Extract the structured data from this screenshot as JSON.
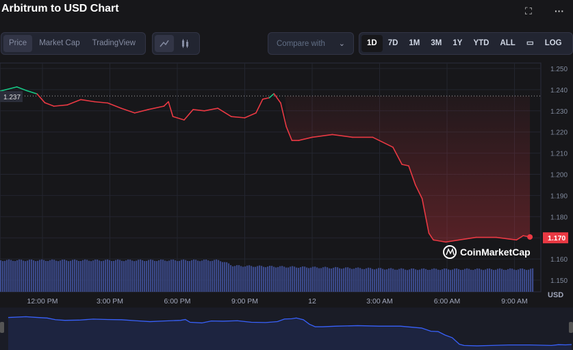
{
  "header": {
    "title": "Arbitrum to USD Chart"
  },
  "tabs": [
    {
      "label": "Price"
    },
    {
      "label": "Market Cap"
    },
    {
      "label": "TradingView"
    }
  ],
  "compare": {
    "label": "Compare with"
  },
  "ranges": [
    {
      "label": "1D"
    },
    {
      "label": "7D"
    },
    {
      "label": "1M"
    },
    {
      "label": "3M"
    },
    {
      "label": "1Y"
    },
    {
      "label": "YTD"
    },
    {
      "label": "ALL"
    }
  ],
  "log_label": "LOG",
  "watermark": "CoinMarketCap",
  "colors": {
    "down": "#ea3943",
    "up": "#16c784",
    "volume": "#3b4a8a",
    "nav": "#3861fb"
  },
  "chart_data": {
    "type": "line",
    "title": "Arbitrum to USD Chart",
    "ylabel": "USD",
    "ylim": [
      1.145,
      1.252
    ],
    "yticks": [
      "1.250",
      "1.240",
      "1.230",
      "1.220",
      "1.210",
      "1.200",
      "1.190",
      "1.180",
      "1.170",
      "1.160",
      "1.150"
    ],
    "xticks": [
      "12:00 PM",
      "3:00 PM",
      "6:00 PM",
      "9:00 PM",
      "12",
      "3:00 AM",
      "6:00 AM",
      "9:00 AM"
    ],
    "open_price": "1.237",
    "current_price": "1.170",
    "x_hours": [
      0,
      0.75,
      1.2,
      1.65,
      2,
      2.4,
      3,
      3.6,
      4.2,
      4.8,
      5.4,
      6,
      6.6,
      7.3,
      7.5,
      7.7,
      8.2,
      8.6,
      9.1,
      9.7,
      10.3,
      10.9,
      11.4,
      11.7,
      12,
      12.2,
      12.5,
      12.75,
      13,
      13.3,
      13.9,
      14.8,
      15.7,
      16.6,
      17.5,
      17.9,
      18.2,
      18.5,
      18.8,
      19.1,
      19.3,
      19.85,
      20.45,
      21.2,
      22.1,
      23,
      23.3,
      23.6
    ],
    "values": [
      1.2393,
      1.2413,
      1.2395,
      1.238,
      1.2338,
      1.2322,
      1.2328,
      1.2353,
      1.2343,
      1.2337,
      1.2312,
      1.229,
      1.2306,
      1.2322,
      1.2343,
      1.2273,
      1.2257,
      1.2306,
      1.23,
      1.2312,
      1.2273,
      1.2267,
      1.229,
      1.2355,
      1.2362,
      1.2381,
      1.2337,
      1.2225,
      1.216,
      1.216,
      1.2175,
      1.2188,
      1.2175,
      1.2175,
      1.2128,
      1.2047,
      1.204,
      1.195,
      1.1885,
      1.1722,
      1.169,
      1.168,
      1.169,
      1.1702,
      1.1702,
      1.169,
      1.171,
      1.1704
    ]
  }
}
